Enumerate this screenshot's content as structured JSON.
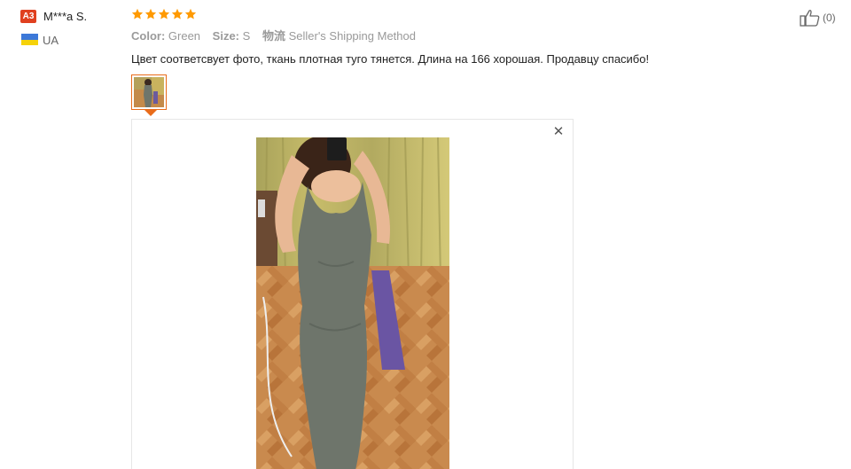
{
  "reviewer": {
    "level_badge": "A3",
    "name": "M***a S.",
    "country": "UA",
    "flag_colors": [
      "#3c78d8",
      "#f5d20a"
    ]
  },
  "review": {
    "rating": 5,
    "rating_max": 5,
    "star_color": "#ff9a00",
    "attributes": {
      "color_label": "Color:",
      "color_value": "Green",
      "size_label": "Size:",
      "size_value": "S",
      "shipping_label": "物流",
      "shipping_value": "Seller's Shipping Method"
    },
    "text": "Цвет соответсвует фото, ткань плотная туго тянется. Длина на 166 хорошая. Продавцу спасибо!",
    "photos_count": 1,
    "preview_close_icon": "close-icon"
  },
  "helpful": {
    "icon": "thumbs-up-icon",
    "count_text": "(0)"
  },
  "accent_color": "#e96c1a"
}
